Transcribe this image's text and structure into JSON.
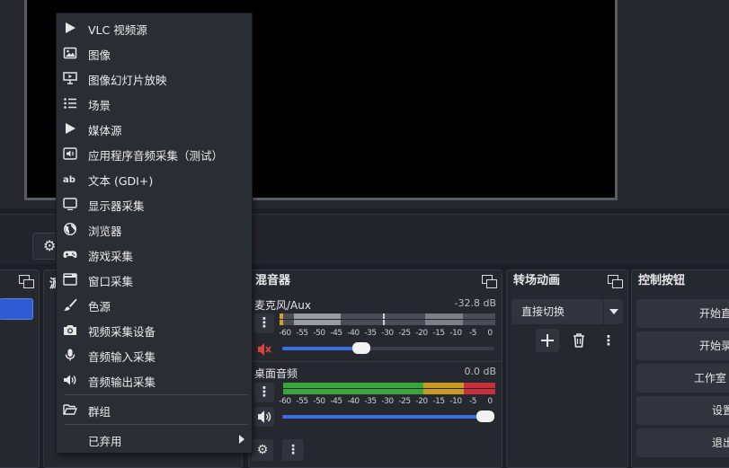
{
  "menu": {
    "items": [
      {
        "label": "VLC 视频源",
        "icon": "play-icon"
      },
      {
        "label": "图像",
        "icon": "image-icon"
      },
      {
        "label": "图像幻灯片放映",
        "icon": "slideshow-icon"
      },
      {
        "label": "场景",
        "icon": "list-icon"
      },
      {
        "label": "媒体源",
        "icon": "play-icon"
      },
      {
        "label": "应用程序音频采集（测试）",
        "icon": "app-audio-icon"
      },
      {
        "label": "文本 (GDI+)",
        "icon": "text-icon"
      },
      {
        "label": "显示器采集",
        "icon": "monitor-icon"
      },
      {
        "label": "浏览器",
        "icon": "globe-icon"
      },
      {
        "label": "游戏采集",
        "icon": "gamepad-icon"
      },
      {
        "label": "窗口采集",
        "icon": "window-icon"
      },
      {
        "label": "色源",
        "icon": "brush-icon"
      },
      {
        "label": "视频采集设备",
        "icon": "camera-icon"
      },
      {
        "label": "音频输入采集",
        "icon": "microphone-icon"
      },
      {
        "label": "音频输出采集",
        "icon": "speaker-icon"
      }
    ],
    "group": {
      "label": "群组",
      "icon": "folder-open-icon"
    },
    "deprecated": {
      "label": "已弃用",
      "icon": "chevron-right-icon"
    }
  },
  "sources": {
    "title": "源"
  },
  "mixer": {
    "title": "混音器",
    "scale": [
      "-60",
      "-55",
      "-50",
      "-45",
      "-40",
      "-35",
      "-30",
      "-25",
      "-20",
      "-15",
      "-10",
      "-5",
      "0"
    ],
    "channels": [
      {
        "name": "麦克风/Aux",
        "db": "-32.8 dB",
        "muted": true,
        "volume": 0.36
      },
      {
        "name": "桌面音频",
        "db": "0.0 dB",
        "muted": false,
        "volume": 1.0
      }
    ]
  },
  "transitions": {
    "title": "转场动画",
    "selected": "直接切换"
  },
  "controls": {
    "title": "控制按钮",
    "buttons": [
      "开始直",
      "开始录",
      "工作室",
      "设置",
      "退出"
    ]
  },
  "colors": {
    "accent": "#3b6fe0",
    "menu_bg": "#2b2d34",
    "panel_bg": "#262830",
    "mute_red": "#d9443c",
    "meter_green": "#3aa53a",
    "meter_yellow": "#c89a22",
    "meter_red": "#c8303a"
  }
}
